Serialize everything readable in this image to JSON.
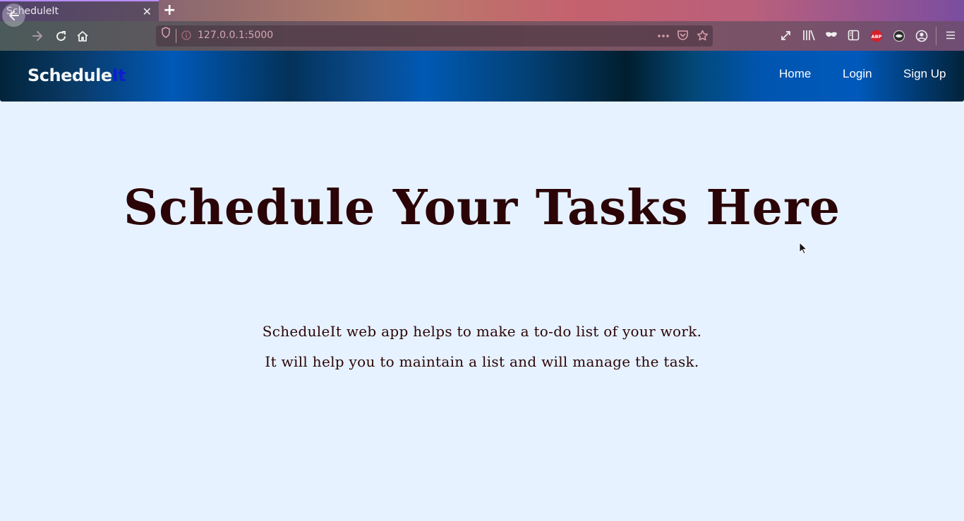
{
  "browser": {
    "tab_title": "ScheduleIt",
    "tab_close": "✕",
    "new_tab": "+",
    "url": "127.0.0.1:5000",
    "icons": [
      "back-icon",
      "forward-icon",
      "reload-icon",
      "home-icon",
      "shield-icon",
      "info-icon",
      "more-icon",
      "pocket-icon",
      "bookmark-star-icon",
      "fullscreen-icon",
      "library-icon",
      "private-mask-icon",
      "sidebar-icon",
      "adblock-icon",
      "extension-icon",
      "account-icon",
      "menu-icon"
    ]
  },
  "navbar": {
    "brand_part1": "Schedule",
    "brand_part2": "It",
    "links": [
      {
        "label": "Home"
      },
      {
        "label": "Login"
      },
      {
        "label": "Sign Up"
      }
    ]
  },
  "hero": {
    "title": "Schedule Your Tasks Here",
    "line1": "ScheduleIt web app helps to make a to-do list of your work.",
    "line2": "It will help you to maintain a list and will manage the task."
  },
  "colors": {
    "page_bg": "#e6f2ff",
    "text": "#2b0407",
    "brand_accent": "#0a1fd1"
  }
}
